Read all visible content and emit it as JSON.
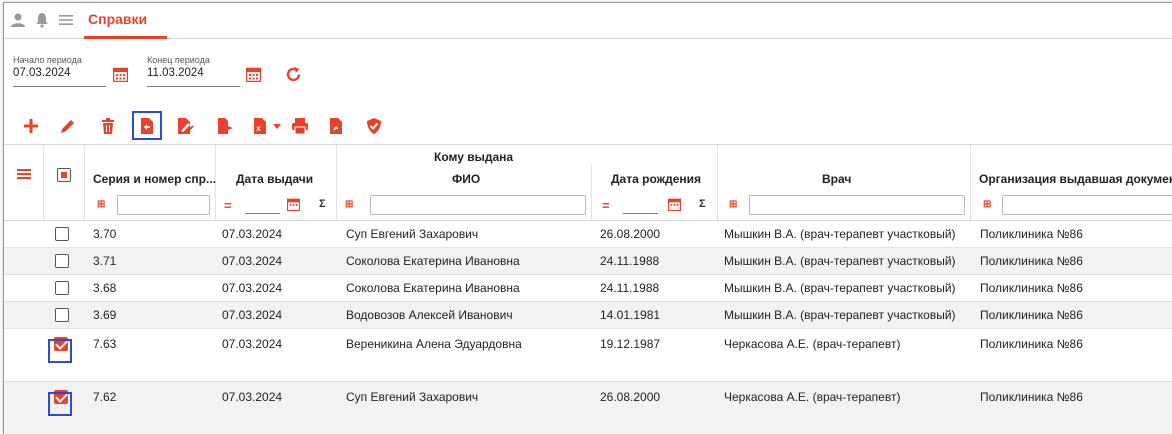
{
  "app": {
    "active_tab": "Справки",
    "accent": "#e8412c",
    "icons": [
      "user-icon",
      "bell-icon",
      "menu-icon"
    ]
  },
  "period": {
    "start_label": "Начало периода",
    "start_value": "07.03.2024",
    "end_label": "Конец периода",
    "end_value": "11.03.2024"
  },
  "toolbar": {
    "icons": [
      "add-icon",
      "edit-icon",
      "delete-icon",
      "export-document-icon",
      "sign-icon",
      "send-icon",
      "excel-export-icon",
      "print-icon",
      "pdf-icon",
      "shield-check-icon"
    ],
    "highlighted": "export-document-icon"
  },
  "table": {
    "group_header": "Кому выдана",
    "columns": {
      "series": "Серия и номер спр...",
      "issue_date": "Дата выдачи",
      "fio": "ФИО",
      "birth_date": "Дата рождения",
      "doctor": "Врач",
      "org": "Организация выдавшая документ"
    },
    "filter_eq": "=",
    "filter_sum": "Σ",
    "rows": [
      {
        "checked": false,
        "series": "3.70",
        "issue_date": "07.03.2024",
        "fio": "Суп Евгений Захарович",
        "birth_date": "26.08.2000",
        "doctor": "Мышкин В.А. (врач-терапевт участковый)",
        "org": "Поликлиника №86"
      },
      {
        "checked": false,
        "series": "3.71",
        "issue_date": "07.03.2024",
        "fio": "Соколова Екатерина Ивановна",
        "birth_date": "24.11.1988",
        "doctor": "Мышкин В.А. (врач-терапевт участковый)",
        "org": "Поликлиника №86"
      },
      {
        "checked": false,
        "series": "3.68",
        "issue_date": "07.03.2024",
        "fio": "Соколова Екатерина Ивановна",
        "birth_date": "24.11.1988",
        "doctor": "Мышкин В.А. (врач-терапевт участковый)",
        "org": "Поликлиника №86"
      },
      {
        "checked": false,
        "series": "3.69",
        "issue_date": "07.03.2024",
        "fio": "Водовозов Алексей Иванович",
        "birth_date": "14.01.1981",
        "doctor": "Мышкин В.А. (врач-терапевт участковый)",
        "org": "Поликлиника №86"
      },
      {
        "checked": true,
        "series": "7.63",
        "issue_date": "07.03.2024",
        "fio": "Вереникина Алена Эдуардовна",
        "birth_date": "19.12.1987",
        "doctor": "Черкасова А.Е. (врач-терапевт)",
        "org": "Поликлиника №86"
      },
      {
        "checked": true,
        "series": "7.62",
        "issue_date": "07.03.2024",
        "fio": "Суп Евгений Захарович",
        "birth_date": "26.08.2000",
        "doctor": "Черкасова А.Е. (врач-терапевт)",
        "org": "Поликлиника №86"
      }
    ]
  }
}
